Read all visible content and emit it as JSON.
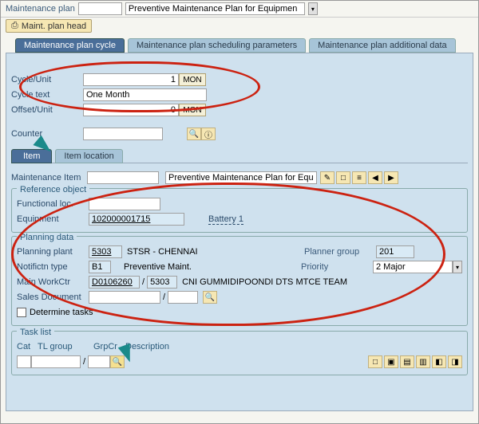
{
  "header": {
    "maint_plan_label": "Maintenance plan",
    "maint_plan_value": "",
    "maint_plan_desc": "Preventive Maintenance Plan for Equipmen",
    "head_btn": "Maint. plan head"
  },
  "tabs": {
    "cycle": "Maintenance plan cycle",
    "sched": "Maintenance plan scheduling parameters",
    "addl": "Maintenance plan additional data"
  },
  "cycle": {
    "cycle_unit_label": "Cycle/Unit",
    "cycle_unit_value": "1",
    "cycle_unit_unit": "MON",
    "cycle_text_label": "Cycle text",
    "cycle_text_value": "One Month",
    "offset_label": "Offset/Unit",
    "offset_value": "0",
    "offset_unit": "MON",
    "counter_label": "Counter",
    "counter_value": ""
  },
  "inner_tabs": {
    "item": "Item",
    "item_loc": "Item location"
  },
  "item": {
    "maint_item_label": "Maintenance Item",
    "maint_item_value": "",
    "maint_item_desc": "Preventive Maintenance Plan for Equipr"
  },
  "ref": {
    "title": "Reference object",
    "floc_label": "Functional loc.",
    "floc_value": "",
    "equip_label": "Equipment",
    "equip_value": "102000001715",
    "equip_desc": "Battery 1"
  },
  "plan": {
    "title": "Planning data",
    "plant_label": "Planning plant",
    "plant_value": "5303",
    "plant_desc": "STSR - CHENNAI",
    "planner_grp_label": "Planner group",
    "planner_grp_value": "201",
    "notif_label": "Notifictn type",
    "notif_value": "B1",
    "notif_desc": "Preventive Maint.",
    "priority_label": "Priority",
    "priority_value": "2 Major",
    "workctr_label": "Main WorkCtr",
    "workctr_value": "D0106260",
    "workctr_plant": "5303",
    "workctr_desc": "CNI GUMMIDIPOONDI DTS MTCE TEAM",
    "salesdoc_label": "Sales Document",
    "salesdoc_value": "",
    "salesdoc_item": "",
    "determine_label": "Determine tasks"
  },
  "tasklist": {
    "title": "Task list",
    "cat_hdr": "Cat",
    "tl_hdr": "TL group",
    "grp_hdr": "GrpCr",
    "desc_hdr": "Description"
  }
}
